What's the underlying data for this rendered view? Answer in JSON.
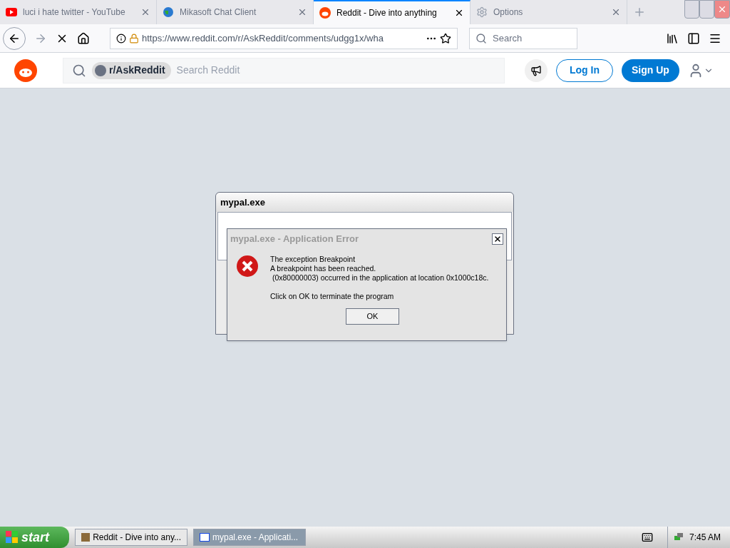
{
  "browser": {
    "tabs": [
      {
        "title": "luci i hate twitter - YouTube",
        "selected": false,
        "kind": "youtube"
      },
      {
        "title": "Mikasoft Chat Client",
        "selected": false,
        "kind": "globe"
      },
      {
        "title": "Reddit - Dive into anything",
        "selected": true,
        "kind": "reddit"
      },
      {
        "title": "Options",
        "selected": false,
        "kind": "gear"
      }
    ],
    "url": "https://www.reddit.com/r/AskReddit/comments/udgg1x/wha",
    "search_placeholder": "Search"
  },
  "reddit": {
    "community": "r/AskReddit",
    "search_placeholder": "Search Reddit",
    "login": "Log In",
    "signup": "Sign Up"
  },
  "back_window": {
    "title": "mypal.exe"
  },
  "error_dialog": {
    "title": "mypal.exe - Application Error",
    "lines": [
      "The exception Breakpoint",
      "A breakpoint has been reached.",
      " (0x80000003) occurred in the application at location 0x1000c18c."
    ],
    "footer": "Click on OK to terminate the program",
    "ok": "OK"
  },
  "taskbar": {
    "start": "start",
    "items": [
      {
        "label": "Reddit - Dive into any...",
        "selected": false
      },
      {
        "label": "mypal.exe - Applicati...",
        "selected": true
      }
    ],
    "clock": "7:45 AM"
  }
}
